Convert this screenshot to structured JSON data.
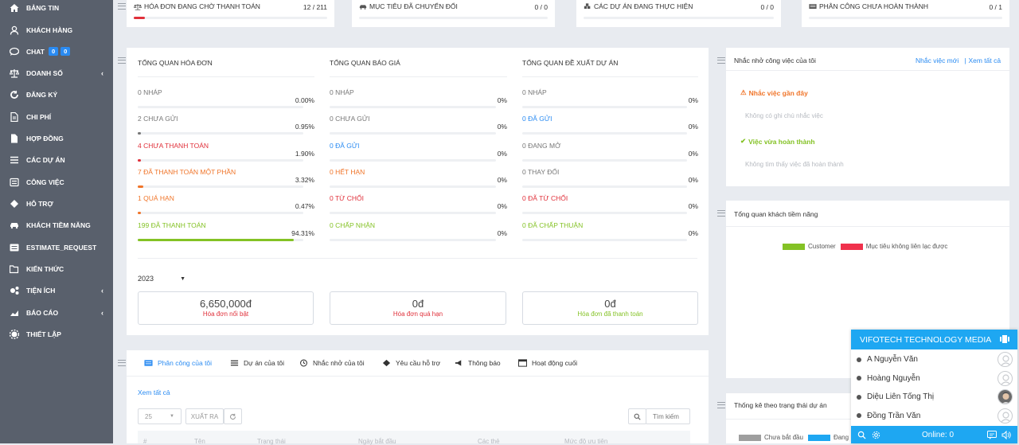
{
  "sidebar": {
    "items": [
      {
        "label": "BẢNG TIN",
        "icon": "home-icon"
      },
      {
        "label": "KHÁCH HÀNG",
        "icon": "user-icon"
      },
      {
        "label": "CHAT",
        "icon": "chat-icon",
        "badges": [
          "0",
          "0"
        ]
      },
      {
        "label": "DOANH SỐ",
        "icon": "balance-scale-icon",
        "chevron": "‹"
      },
      {
        "label": "ĐĂNG KÝ",
        "icon": "refresh-icon"
      },
      {
        "label": "CHI PHÍ",
        "icon": "file-icon"
      },
      {
        "label": "HỢP ĐỒNG",
        "icon": "document-icon"
      },
      {
        "label": "CÁC DỰ ÁN",
        "icon": "bars-icon"
      },
      {
        "label": "CÔNG VIỆC",
        "icon": "list-icon"
      },
      {
        "label": "HỖ TRỢ",
        "icon": "ticket-icon"
      },
      {
        "label": "KHÁCH TIỀM NĂNG",
        "icon": "car-icon"
      },
      {
        "label": "ESTIMATE_REQUEST",
        "icon": "list-alt-icon"
      },
      {
        "label": "KIẾN THỨC",
        "icon": "folder-open-icon"
      },
      {
        "label": "TIỆN ÍCH",
        "icon": "cogs-icon",
        "chevron": "‹"
      },
      {
        "label": "BÁO CÁO",
        "icon": "area-chart-icon",
        "chevron": "‹"
      },
      {
        "label": "THIẾT LẬP",
        "icon": "gear-icon"
      }
    ]
  },
  "stats": [
    {
      "label": "HÓA ĐƠN ĐANG CHỜ THANH TOÁN",
      "value": "12 / 211",
      "icon": "balance-scale-icon",
      "progress": 0.057
    },
    {
      "label": "MỤC TIÊU ĐÃ CHUYỂN ĐỔI",
      "value": "0 / 0",
      "icon": "car-icon",
      "progress": 0
    },
    {
      "label": "CÁC DỰ ÁN ĐANG THỰC HIỆN",
      "value": "0 / 0",
      "icon": "cubes-icon",
      "progress": 0
    },
    {
      "label": "PHÂN CÔNG CHƯA HOÀN THÀNH",
      "value": "0 / 1",
      "icon": "tasks-icon",
      "progress": 0
    }
  ],
  "overview": {
    "invoices": {
      "title": "TỔNG QUAN HÓA ĐƠN",
      "rows": [
        {
          "count": "0",
          "label": "NHÁP",
          "pct": "0.00%",
          "fraction": 0.0,
          "color": "#777777"
        },
        {
          "count": "2",
          "label": "CHƯA GỬI",
          "pct": "0.95%",
          "fraction": 0.0095,
          "color": "#777777"
        },
        {
          "count": "4",
          "label": "CHƯA THANH TOÁN",
          "pct": "1.90%",
          "fraction": 0.019,
          "color": "#e0303a"
        },
        {
          "count": "7",
          "label": "ĐÃ THANH TOÁN MỘT PHẦN",
          "pct": "3.32%",
          "fraction": 0.0332,
          "color": "#f0752a"
        },
        {
          "count": "1",
          "label": "QUÁ HẠN",
          "pct": "0.47%",
          "fraction": 0.0047,
          "color": "#f0752a"
        },
        {
          "count": "199",
          "label": "ĐÃ THANH TOÁN",
          "pct": "94.31%",
          "fraction": 0.9431,
          "color": "#84c225"
        }
      ]
    },
    "estimates": {
      "title": "TỔNG QUAN BÁO GIÁ",
      "rows": [
        {
          "count": "0",
          "label": "NHÁP",
          "pct": "0%",
          "fraction": 0,
          "color": "#777777"
        },
        {
          "count": "0",
          "label": "CHƯA GỬI",
          "pct": "0%",
          "fraction": 0,
          "color": "#777777"
        },
        {
          "count": "0",
          "label": "ĐÃ GỬI",
          "pct": "0%",
          "fraction": 0,
          "color": "#2a8bf2"
        },
        {
          "count": "0",
          "label": "HẾT HẠN",
          "pct": "0%",
          "fraction": 0,
          "color": "#f0752a"
        },
        {
          "count": "0",
          "label": "TỪ CHỐI",
          "pct": "0%",
          "fraction": 0,
          "color": "#e0303a"
        },
        {
          "count": "0",
          "label": "CHẤP NHẬN",
          "pct": "0%",
          "fraction": 0,
          "color": "#84c225"
        }
      ]
    },
    "proposals": {
      "title": "TỔNG QUAN ĐỀ XUẤT DỰ ÁN",
      "rows": [
        {
          "count": "0",
          "label": "NHÁP",
          "pct": "0%",
          "fraction": 0,
          "color": "#777777"
        },
        {
          "count": "0",
          "label": "ĐÃ GỬI",
          "pct": "0%",
          "fraction": 0,
          "color": "#2a8bf2"
        },
        {
          "count": "0",
          "label": "ĐANG MỞ",
          "pct": "0%",
          "fraction": 0,
          "color": "#777777"
        },
        {
          "count": "0",
          "label": "THAY ĐỔI",
          "pct": "0%",
          "fraction": 0,
          "color": "#777777"
        },
        {
          "count": "0",
          "label": "ĐÃ TỪ CHỐI",
          "pct": "0%",
          "fraction": 0,
          "color": "#e0303a"
        },
        {
          "count": "0",
          "label": "ĐÃ CHẤP THUẬN",
          "pct": "0%",
          "fraction": 0,
          "color": "#84c225"
        }
      ]
    },
    "year": "2023",
    "summary": [
      {
        "amount": "6,650,000đ",
        "label": "Hóa đơn nổi bật",
        "color": "#e0303a"
      },
      {
        "amount": "0đ",
        "label": "Hóa đơn quá hạn",
        "color": "#e0303a"
      },
      {
        "amount": "0đ",
        "label": "Hóa đơn đã thanh toán",
        "color": "#84c225"
      }
    ]
  },
  "tabs": {
    "items": [
      {
        "label": "Phân công của tôi",
        "icon": "tasks-icon",
        "active": true
      },
      {
        "label": "Dự án của tôi",
        "icon": "bars-icon"
      },
      {
        "label": "Nhắc nhở của tôi",
        "icon": "clock-icon"
      },
      {
        "label": "Yêu cầu hỗ trợ",
        "icon": "ticket-icon"
      },
      {
        "label": "Thông báo",
        "icon": "bullhorn-icon"
      },
      {
        "label": "Hoạt động cuối",
        "icon": "window-icon"
      }
    ],
    "view_all": "Xem tất cả",
    "page_size": "25",
    "export": "XUẤT RA",
    "search_placeholder": "Tìm kiếm",
    "columns": [
      "#",
      "Tên",
      "Trạng thái",
      "Ngày bắt đầu",
      "Các thẻ",
      "Mức độ ưu tiên"
    ]
  },
  "reminders": {
    "title": "Nhắc nhở công việc của tôi",
    "new_link": "Nhắc việc mới",
    "sep": "|",
    "view_all": "Xem tất cả",
    "recent": "Nhắc việc gần đây",
    "recent_empty": "Không có ghi chú nhắc việc",
    "done": "Việc vừa hoàn thành",
    "done_empty": "Không tìm thấy việc đã hoàn thành"
  },
  "leads": {
    "title": "Tổng quan khách tiềm năng",
    "legend": [
      {
        "name": "Customer",
        "color": "#84c225"
      },
      {
        "name": "Mục tiêu không liên lạc được",
        "color": "#f0314c"
      }
    ]
  },
  "project_stats": {
    "title": "Thống kê theo trạng thái dự án",
    "legend": [
      {
        "name": "Chưa bắt đầu",
        "color": "#9e9e9e"
      },
      {
        "name": "Đang",
        "color": "#1ea7f2"
      }
    ]
  },
  "chat": {
    "title": "VIFOTECH TECHNOLOGY MEDIA",
    "users": [
      "A Nguyễn Văn",
      "Hoàng Nguyễn",
      "Diệu Liên Tống Thị",
      "Đồng Trần Văn"
    ],
    "online": "Online: 0"
  }
}
